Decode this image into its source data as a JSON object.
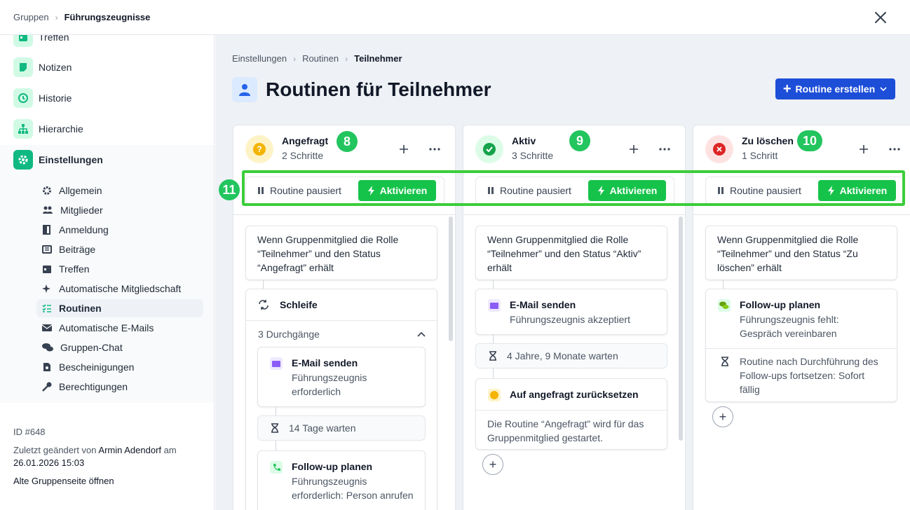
{
  "header": {
    "crumb_parent": "Gruppen",
    "crumb_current": "Führungszeugnisse"
  },
  "sidebar": {
    "items": [
      {
        "label": "Treffen"
      },
      {
        "label": "Notizen"
      },
      {
        "label": "Historie"
      },
      {
        "label": "Hierarchie"
      },
      {
        "label": "Einstellungen"
      }
    ],
    "sub": [
      {
        "label": "Allgemein"
      },
      {
        "label": "Mitglieder"
      },
      {
        "label": "Anmeldung"
      },
      {
        "label": "Beiträge"
      },
      {
        "label": "Treffen"
      },
      {
        "label": "Automatische Mitgliedschaft"
      },
      {
        "label": "Routinen"
      },
      {
        "label": "Automatische E-Mails"
      },
      {
        "label": "Gruppen-Chat"
      },
      {
        "label": "Bescheinigungen"
      },
      {
        "label": "Berechtigungen"
      }
    ],
    "id": "ID #648",
    "changed_prefix": "Zuletzt geändert von ",
    "changed_by": "Armin Adendorf",
    "changed_at": " am",
    "changed_date": "26.01.2026 15:03",
    "old_page": "Alte Gruppenseite öffnen"
  },
  "main": {
    "breadcrumb": [
      "Einstellungen",
      "Routinen",
      "Teilnehmer"
    ],
    "title": "Routinen für Teilnehmer",
    "create_label": "Routine erstellen"
  },
  "columns": [
    {
      "title": "Angefragt",
      "steps": "2 Schritte",
      "badge": "8",
      "status_color": "#f4b400",
      "paused": "Routine pausiert",
      "activate": "Aktivieren",
      "trigger": "Wenn Gruppenmitglied die Rolle “Teilnehmer” und den Status “Angefragt” erhält",
      "loop_label": "Schleife",
      "loop_count": "3 Durchgänge",
      "step1_title": "E-Mail senden",
      "step1_sub": "Führungszeugnis erforderlich",
      "wait": "14 Tage warten",
      "step2_title": "Follow-up planen",
      "step2_sub": "Führungszeugnis erforderlich: Person anrufen"
    },
    {
      "title": "Aktiv",
      "steps": "3 Schritte",
      "badge": "9",
      "status_color": "#16a34a",
      "paused": "Routine pausiert",
      "activate": "Aktivieren",
      "trigger": "Wenn Gruppenmitglied die Rolle “Teilnehmer” und den Status “Aktiv” erhält",
      "step1_title": "E-Mail senden",
      "step1_sub": "Führungszeugnis akzeptiert",
      "wait": "4 Jahre, 9 Monate warten",
      "step2_title": "Auf angefragt zurücksetzen",
      "step2_sub": "Die Routine “Angefragt” wird für das Gruppenmitglied gestartet."
    },
    {
      "title": "Zu löschen",
      "steps": "1 Schritt",
      "badge": "10",
      "status_color": "#dc2626",
      "paused": "Routine pausiert",
      "activate": "Aktivieren",
      "trigger": "Wenn Gruppenmitglied die Rolle “Teilnehmer” und den Status “Zu löschen” erhält",
      "step1_title": "Follow-up planen",
      "step1_sub": "Führungszeugnis fehlt: Gespräch vereinbaren",
      "step2_sub": "Routine nach Durchführung des Follow-ups fortsetzen: Sofort fällig"
    }
  ],
  "annotation_badge": "11"
}
